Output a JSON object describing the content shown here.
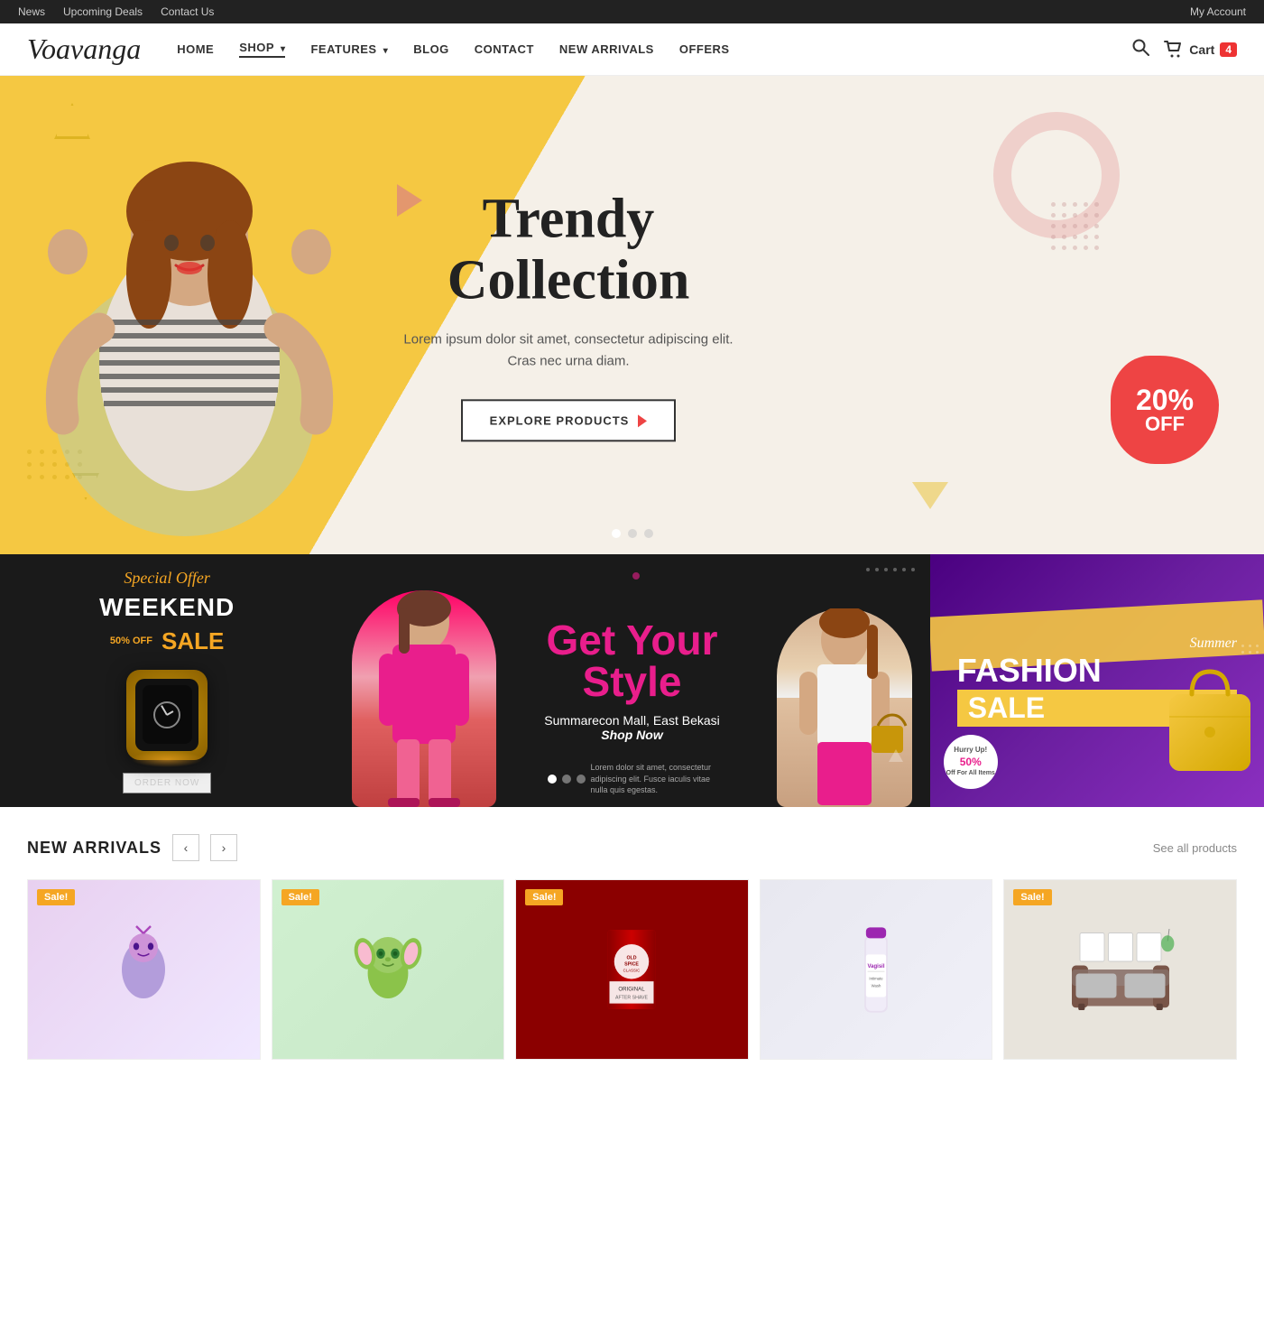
{
  "topbar": {
    "links": [
      "News",
      "Upcoming Deals",
      "Contact Us"
    ],
    "account": "My Account"
  },
  "header": {
    "logo": "Voavanga",
    "nav": [
      {
        "label": "HOME",
        "active": false,
        "has_dropdown": false
      },
      {
        "label": "SHOP",
        "active": true,
        "has_dropdown": true
      },
      {
        "label": "FEATURES",
        "active": false,
        "has_dropdown": true
      },
      {
        "label": "BLOG",
        "active": false,
        "has_dropdown": false
      },
      {
        "label": "CONTACT",
        "active": false,
        "has_dropdown": false
      },
      {
        "label": "NEW ARRIVALS",
        "active": false,
        "has_dropdown": false
      },
      {
        "label": "OFFERS",
        "active": false,
        "has_dropdown": false
      }
    ],
    "cart_label": "Cart",
    "cart_count": "4"
  },
  "hero": {
    "title_line1": "Trendy",
    "title_line2": "Collection",
    "subtitle": "Lorem ipsum dolor sit amet, consectetur adipiscing elit. Cras nec urna diam.",
    "cta_label": "EXPLORE PRODUCTS",
    "discount_pct": "20%",
    "discount_label": "OFF"
  },
  "promo_banners": {
    "banner1": {
      "special_offer": "Special Offer",
      "title1": "WEEKEND",
      "title2": "SALE",
      "off_text": "50% OFF",
      "order_btn": "ORDER NOW"
    },
    "banner2": {
      "line1": "Get Your",
      "line2": "Style",
      "location": "Summarecon Mall, East Bekasi",
      "shop_now": "Shop Now",
      "small_text": "Lorem dolor sit amet, consectetur adipiscing elit. Fusce iaculis vitae nulla quis egestas."
    },
    "banner3": {
      "summer": "Summer",
      "fashion": "FASHION",
      "sale": "SALE",
      "badge_top": "Hurry Up!",
      "badge_off": "50%",
      "badge_bottom": "Off For All Items"
    }
  },
  "new_arrivals": {
    "title": "NEW ARRIVALS",
    "see_all": "See all products",
    "products": [
      {
        "has_sale": true
      },
      {
        "has_sale": true
      },
      {
        "has_sale": true
      },
      {
        "has_sale": false
      },
      {
        "has_sale": true
      }
    ],
    "sale_label": "Sale!"
  }
}
